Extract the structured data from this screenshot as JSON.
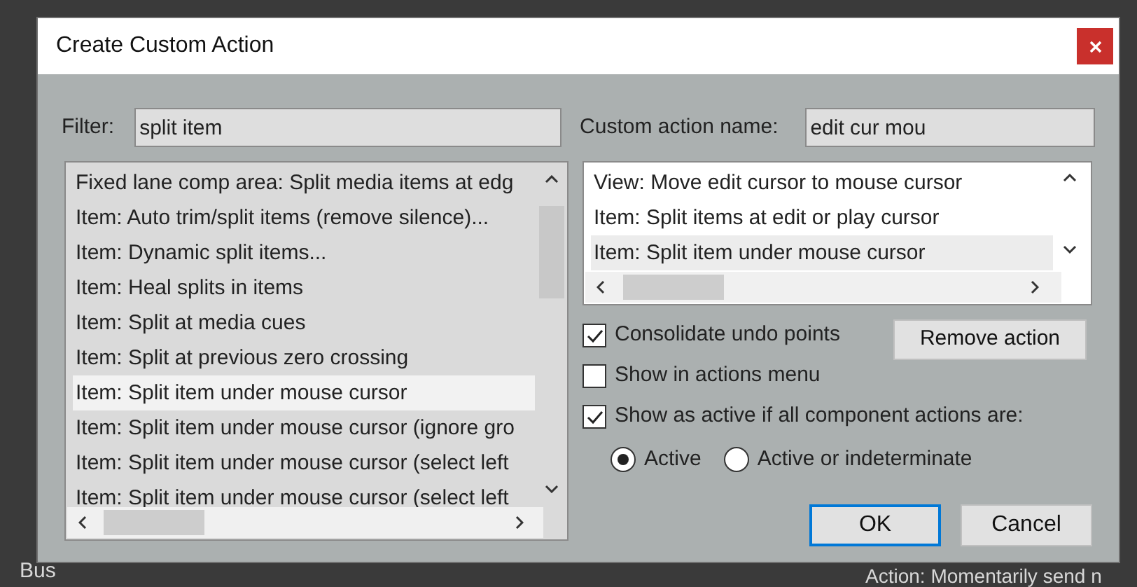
{
  "window": {
    "title": "Create Custom Action"
  },
  "filter": {
    "label": "Filter:",
    "value": "split item"
  },
  "name_field": {
    "label": "Custom action name:",
    "value": "edit cur mou"
  },
  "available_actions": [
    {
      "label": "Fixed lane comp area: Split media items at edg",
      "selected": false
    },
    {
      "label": "Item: Auto trim/split items (remove silence)...",
      "selected": false
    },
    {
      "label": "Item: Dynamic split items...",
      "selected": false
    },
    {
      "label": "Item: Heal splits in items",
      "selected": false
    },
    {
      "label": "Item: Split at media cues",
      "selected": false
    },
    {
      "label": "Item: Split at previous zero crossing",
      "selected": false
    },
    {
      "label": "Item: Split item under mouse cursor",
      "selected": true
    },
    {
      "label": "Item: Split item under mouse cursor (ignore gro",
      "selected": false
    },
    {
      "label": "Item: Split item under mouse cursor (select left",
      "selected": false
    },
    {
      "label": "Item: Split item under mouse cursor (select left",
      "selected": false
    }
  ],
  "custom_actions": [
    {
      "label": "View: Move edit cursor to mouse cursor",
      "selected": false
    },
    {
      "label": "Item: Split items at edit or play cursor",
      "selected": false
    },
    {
      "label": "Item: Split item under mouse cursor",
      "selected": true
    }
  ],
  "options": [
    {
      "label": "Consolidate undo points",
      "checked": true
    },
    {
      "label": "Show in actions menu",
      "checked": false
    },
    {
      "label": "Show as active if all component actions are:",
      "checked": true
    }
  ],
  "active_mode": [
    {
      "label": "Active",
      "selected": true
    },
    {
      "label": "Active or indeterminate",
      "selected": false
    }
  ],
  "remove_button": "Remove action",
  "buttons": [
    {
      "label": "OK",
      "default": true
    },
    {
      "label": "Cancel",
      "default": false
    }
  ],
  "background": {
    "track_label": "Bus",
    "action_text": "Action: Momentarily send n"
  }
}
